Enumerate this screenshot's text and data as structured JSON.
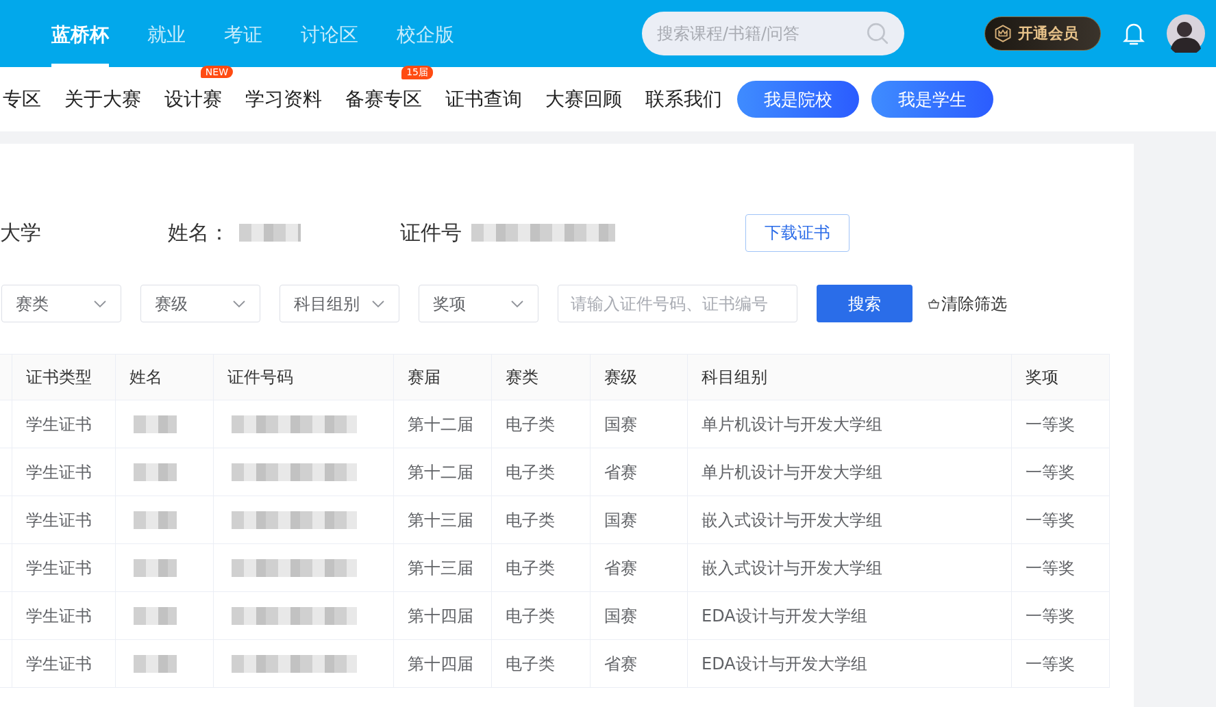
{
  "top_nav": {
    "items": [
      {
        "label": "蓝桥杯",
        "selected": true
      },
      {
        "label": "就业",
        "selected": false
      },
      {
        "label": "考证",
        "selected": false
      },
      {
        "label": "讨论区",
        "selected": false
      },
      {
        "label": "校企版",
        "selected": false
      }
    ],
    "search": {
      "placeholder": "搜索课程/书籍/问答"
    },
    "vip_button": "开通会员"
  },
  "sub_nav": {
    "items": [
      {
        "label": "专区"
      },
      {
        "label": "关于大赛"
      },
      {
        "label": "设计赛",
        "badge": "NEW"
      },
      {
        "label": "学习资料"
      },
      {
        "label": "备赛专区",
        "badge": "15届"
      },
      {
        "label": "证书查询"
      },
      {
        "label": "大赛回顾"
      },
      {
        "label": "联系我们"
      }
    ],
    "buttons": [
      "我是院校",
      "我是学生"
    ]
  },
  "info": {
    "school": "大学",
    "name_label": "姓名：",
    "id_label": "证件号",
    "download_button": "下载证书"
  },
  "filters": {
    "selects": [
      "赛类",
      "赛级",
      "科目组别",
      "奖项"
    ],
    "search_field": {
      "placeholder": "请输入证件号码、证书编号"
    },
    "search_button": "搜索",
    "clear_button": "清除筛选"
  },
  "table": {
    "columns": [
      "证书类型",
      "姓名",
      "证件号码",
      "赛届",
      "赛类",
      "赛级",
      "科目组别",
      "奖项"
    ],
    "rows": [
      [
        {
          "kind": "text",
          "text": "学生证书"
        },
        {
          "kind": "redacted"
        },
        {
          "kind": "redacted"
        },
        {
          "kind": "text",
          "text": "第十二届"
        },
        {
          "kind": "text",
          "text": "电子类"
        },
        {
          "kind": "text",
          "text": "国赛"
        },
        {
          "kind": "text",
          "text": "单片机设计与开发大学组"
        },
        {
          "kind": "text",
          "text": "一等奖"
        }
      ],
      [
        {
          "kind": "text",
          "text": "学生证书"
        },
        {
          "kind": "redacted"
        },
        {
          "kind": "redacted"
        },
        {
          "kind": "text",
          "text": "第十二届"
        },
        {
          "kind": "text",
          "text": "电子类"
        },
        {
          "kind": "text",
          "text": "省赛"
        },
        {
          "kind": "text",
          "text": "单片机设计与开发大学组"
        },
        {
          "kind": "text",
          "text": "一等奖"
        }
      ],
      [
        {
          "kind": "text",
          "text": "学生证书"
        },
        {
          "kind": "redacted"
        },
        {
          "kind": "redacted"
        },
        {
          "kind": "text",
          "text": "第十三届"
        },
        {
          "kind": "text",
          "text": "电子类"
        },
        {
          "kind": "text",
          "text": "国赛"
        },
        {
          "kind": "text",
          "text": "嵌入式设计与开发大学组"
        },
        {
          "kind": "text",
          "text": "一等奖"
        }
      ],
      [
        {
          "kind": "text",
          "text": "学生证书"
        },
        {
          "kind": "redacted"
        },
        {
          "kind": "redacted"
        },
        {
          "kind": "text",
          "text": "第十三届"
        },
        {
          "kind": "text",
          "text": "电子类"
        },
        {
          "kind": "text",
          "text": "省赛"
        },
        {
          "kind": "text",
          "text": "嵌入式设计与开发大学组"
        },
        {
          "kind": "text",
          "text": "一等奖"
        }
      ],
      [
        {
          "kind": "text",
          "text": "学生证书"
        },
        {
          "kind": "redacted"
        },
        {
          "kind": "redacted"
        },
        {
          "kind": "text",
          "text": "第十四届"
        },
        {
          "kind": "text",
          "text": "电子类"
        },
        {
          "kind": "text",
          "text": "国赛"
        },
        {
          "kind": "text",
          "text": "EDA设计与开发大学组"
        },
        {
          "kind": "text",
          "text": "一等奖"
        }
      ],
      [
        {
          "kind": "text",
          "text": "学生证书"
        },
        {
          "kind": "redacted"
        },
        {
          "kind": "redacted"
        },
        {
          "kind": "text",
          "text": "第十四届"
        },
        {
          "kind": "text",
          "text": "电子类"
        },
        {
          "kind": "text",
          "text": "省赛"
        },
        {
          "kind": "text",
          "text": "EDA设计与开发大学组"
        },
        {
          "kind": "text",
          "text": "一等奖"
        }
      ]
    ]
  }
}
